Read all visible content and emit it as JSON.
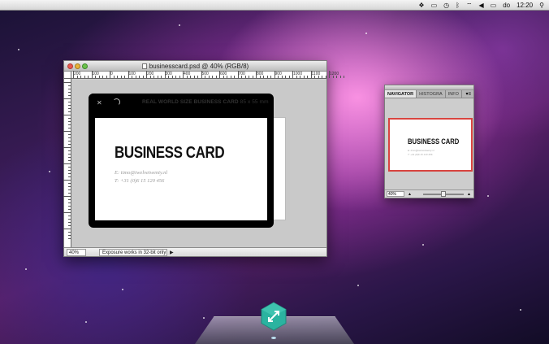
{
  "menubar": {
    "day": "do",
    "time": "12:20",
    "icons": [
      "evernote-icon",
      "display-icon",
      "timemachine-icon",
      "bluetooth-icon",
      "wifi-icon",
      "volume-icon",
      "battery-icon",
      "spotlight-icon"
    ]
  },
  "psd_window": {
    "title": "businesscard.psd @ 40% (RGB/8)",
    "ruler_ticks": [
      "200",
      "100",
      "0",
      "100",
      "200",
      "300",
      "400",
      "500",
      "600",
      "700",
      "800",
      "900",
      "1000",
      "1100",
      "1200"
    ],
    "zoom": "40%",
    "status_text": "Exposure works in 32-bit only",
    "frame_label_bold": "REAL WORLD SIZE BUSINESS CARD",
    "frame_label_dim": "85 x 55 mm",
    "card": {
      "title": "BUSINESS CARD",
      "email": "E: timo@twelvetwenty.nl",
      "phone": "T: +31 (0)6 15 120 456"
    }
  },
  "navigator": {
    "tabs": [
      "NAVIGATOR",
      "HISTOGRA",
      "INFO"
    ],
    "zoom": "40%",
    "preview_title": "BUSINESS CARD",
    "preview_email": "E: timo@twelvetwenty.nl",
    "preview_phone": "T: +31 (0)6 15 120 456"
  },
  "dock": {
    "app_icon": "expand-arrows-icon",
    "accent": "#2bb3a0"
  }
}
